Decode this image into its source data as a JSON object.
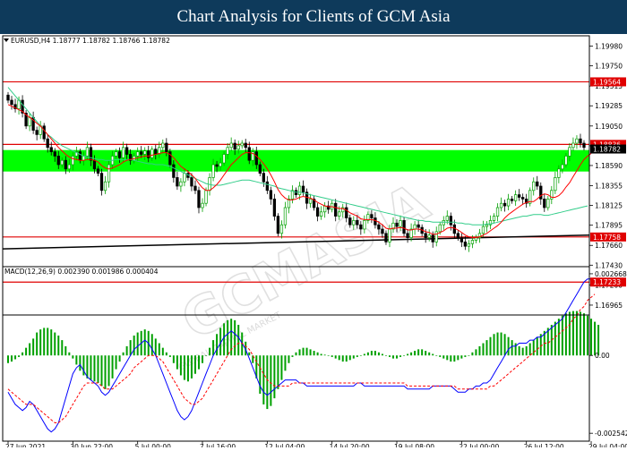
{
  "page_title": "Chart Analysis for Clients of GCM Asia",
  "watermark": "GCMASIA",
  "watermark_sub": "GLOBAL CAPITAL MARKET",
  "chart_data": [
    {
      "type": "candlestick",
      "panel": "price",
      "symbol_label": "EURUSD,H4  1.18777 1.18782 1.18766 1.18782",
      "ylim": [
        1.1685,
        1.201
      ],
      "y_ticks": [
        1.1998,
        1.1975,
        1.19515,
        1.19285,
        1.1905,
        1.1882,
        1.1859,
        1.18355,
        1.18125,
        1.17895,
        1.1766,
        1.1743,
        1.172,
        1.16965
      ],
      "y_tick_labels": [
        "1.19980",
        "1.19750",
        "1.19515",
        "1.19285",
        "1.19050",
        "1.18820",
        "1.18590",
        "1.18355",
        "1.18125",
        "1.17895",
        "1.17660",
        "1.17430",
        "1.17200",
        "1.16965"
      ],
      "x_labels": [
        "27 Jun 2021",
        "30 Jun 22:00",
        "5 Jul 00:00",
        "7 Jul 16:00",
        "12 Jul 04:00",
        "14 Jul 20:00",
        "19 Jul 08:00",
        "22 Jul 00:00",
        "26 Jul 12:00",
        "29 Jul 04:00"
      ],
      "x_label_bar_index": [
        0,
        18,
        36,
        54,
        72,
        90,
        108,
        126,
        144,
        162
      ],
      "closes": [
        1.1935,
        1.193,
        1.1925,
        1.1935,
        1.192,
        1.1905,
        1.1915,
        1.19,
        1.1895,
        1.1905,
        1.189,
        1.188,
        1.1875,
        1.187,
        1.186,
        1.1865,
        1.1855,
        1.186,
        1.187,
        1.1875,
        1.1865,
        1.187,
        1.188,
        1.1865,
        1.1855,
        1.185,
        1.183,
        1.184,
        1.186,
        1.187,
        1.1875,
        1.1868,
        1.188,
        1.1872,
        1.1865,
        1.187,
        1.1875,
        1.1872,
        1.1876,
        1.1868,
        1.1878,
        1.1872,
        1.188,
        1.1885,
        1.1875,
        1.186,
        1.1845,
        1.1835,
        1.184,
        1.185,
        1.1845,
        1.1835,
        1.183,
        1.181,
        1.1815,
        1.183,
        1.1845,
        1.186,
        1.1858,
        1.1862,
        1.1872,
        1.188,
        1.1885,
        1.1878,
        1.1882,
        1.1885,
        1.188,
        1.1865,
        1.1875,
        1.186,
        1.185,
        1.184,
        1.183,
        1.182,
        1.18,
        1.178,
        1.179,
        1.181,
        1.182,
        1.183,
        1.1825,
        1.1835,
        1.1828,
        1.1815,
        1.182,
        1.181,
        1.18,
        1.1805,
        1.1812,
        1.1808,
        1.1815,
        1.18,
        1.1805,
        1.181,
        1.1798,
        1.179,
        1.1795,
        1.179,
        1.1785,
        1.1795,
        1.1802,
        1.1798,
        1.179,
        1.1785,
        1.178,
        1.177,
        1.1785,
        1.1792,
        1.1788,
        1.1795,
        1.178,
        1.1775,
        1.1785,
        1.179,
        1.1787,
        1.178,
        1.1775,
        1.1778,
        1.177,
        1.1782,
        1.179,
        1.1795,
        1.18,
        1.179,
        1.178,
        1.1775,
        1.177,
        1.1765,
        1.1768,
        1.1772,
        1.1775,
        1.178,
        1.1788,
        1.179,
        1.1795,
        1.18,
        1.181,
        1.1815,
        1.1812,
        1.182,
        1.1818,
        1.1825,
        1.1822,
        1.182,
        1.1815,
        1.183,
        1.184,
        1.1835,
        1.182,
        1.181,
        1.182,
        1.183,
        1.1845,
        1.1855,
        1.186,
        1.187,
        1.188,
        1.1885,
        1.189,
        1.1885,
        1.188
      ],
      "ma_slow": [
        1.195,
        1.1945,
        1.194,
        1.1935,
        1.193,
        1.1925,
        1.192,
        1.1915,
        1.191,
        1.1905,
        1.19,
        1.1895,
        1.1892,
        1.1888,
        1.1885,
        1.1882,
        1.188,
        1.1878,
        1.1876,
        1.1874,
        1.1872,
        1.187,
        1.1869,
        1.1868,
        1.1867,
        1.1866,
        1.1866,
        1.1865,
        1.1865,
        1.1865,
        1.1866,
        1.1866,
        1.1866,
        1.1866,
        1.1866,
        1.1865,
        1.1864,
        1.1863,
        1.1862,
        1.1861,
        1.1861,
        1.186,
        1.186,
        1.186,
        1.1859,
        1.1858,
        1.1856,
        1.1854,
        1.1852,
        1.185,
        1.1848,
        1.1846,
        1.1844,
        1.1842,
        1.184,
        1.1838,
        1.1837,
        1.1836,
        1.1836,
        1.1836,
        1.1837,
        1.1838,
        1.1839,
        1.184,
        1.1841,
        1.1842,
        1.1842,
        1.1842,
        1.1841,
        1.184,
        1.1839,
        1.1838,
        1.1837,
        1.1836,
        1.1835,
        1.1833,
        1.1832,
        1.1831,
        1.183,
        1.1829,
        1.1828,
        1.1828,
        1.1827,
        1.1826,
        1.1825,
        1.1824,
        1.1823,
        1.1822,
        1.1821,
        1.182,
        1.1819,
        1.1818,
        1.1817,
        1.1816,
        1.1815,
        1.1814,
        1.1813,
        1.1812,
        1.1811,
        1.181,
        1.1809,
        1.1808,
        1.1807,
        1.1806,
        1.1805,
        1.1804,
        1.1803,
        1.1802,
        1.1801,
        1.18,
        1.1799,
        1.1798,
        1.1797,
        1.1796,
        1.1795,
        1.1795,
        1.1794,
        1.1794,
        1.1793,
        1.1793,
        1.1793,
        1.1793,
        1.1793,
        1.1793,
        1.1793,
        1.1792,
        1.1792,
        1.1791,
        1.1791,
        1.179,
        1.179,
        1.179,
        1.179,
        1.1791,
        1.1791,
        1.1792,
        1.1793,
        1.1794,
        1.1795,
        1.1796,
        1.1797,
        1.1798,
        1.1799,
        1.18,
        1.18,
        1.1801,
        1.1802,
        1.1802,
        1.1802,
        1.1801,
        1.1801,
        1.1802,
        1.1803,
        1.1804,
        1.1805,
        1.1806,
        1.1807,
        1.1808,
        1.1809,
        1.181,
        1.1811,
        1.1812
      ],
      "ma_fast": [
        1.193,
        1.1928,
        1.1926,
        1.1924,
        1.1922,
        1.1918,
        1.1915,
        1.1912,
        1.1908,
        1.1905,
        1.19,
        1.1895,
        1.189,
        1.1885,
        1.188,
        1.1876,
        1.1872,
        1.1869,
        1.1867,
        1.1866,
        1.1865,
        1.1865,
        1.1866,
        1.1866,
        1.1865,
        1.1863,
        1.1859,
        1.1856,
        1.1855,
        1.1856,
        1.1858,
        1.186,
        1.1863,
        1.1865,
        1.1866,
        1.1867,
        1.1868,
        1.1869,
        1.187,
        1.187,
        1.1871,
        1.1872,
        1.1873,
        1.1874,
        1.1874,
        1.1872,
        1.1868,
        1.1863,
        1.1858,
        1.1855,
        1.1852,
        1.1848,
        1.1844,
        1.1838,
        1.1833,
        1.183,
        1.183,
        1.1833,
        1.1837,
        1.1842,
        1.1848,
        1.1854,
        1.186,
        1.1864,
        1.1868,
        1.1872,
        1.1874,
        1.1874,
        1.1873,
        1.187,
        1.1866,
        1.1861,
        1.1855,
        1.1848,
        1.184,
        1.1831,
        1.1825,
        1.1821,
        1.1819,
        1.1819,
        1.182,
        1.1822,
        1.1823,
        1.1822,
        1.1821,
        1.1819,
        1.1816,
        1.1814,
        1.1812,
        1.1811,
        1.1811,
        1.181,
        1.1809,
        1.1809,
        1.1807,
        1.1804,
        1.1802,
        1.18,
        1.1797,
        1.1796,
        1.1796,
        1.1796,
        1.1795,
        1.1793,
        1.179,
        1.1786,
        1.1785,
        1.1786,
        1.1786,
        1.1787,
        1.1786,
        1.1784,
        1.1784,
        1.1785,
        1.1785,
        1.1784,
        1.1782,
        1.1781,
        1.1779,
        1.1779,
        1.1781,
        1.1783,
        1.1786,
        1.1787,
        1.1786,
        1.1784,
        1.1781,
        1.1778,
        1.1776,
        1.1775,
        1.1775,
        1.1776,
        1.1778,
        1.178,
        1.1783,
        1.1786,
        1.1789,
        1.1793,
        1.1798,
        1.1802,
        1.1805,
        1.1808,
        1.1811,
        1.1814,
        1.1816,
        1.1817,
        1.1817,
        1.182,
        1.1824,
        1.1826,
        1.1825,
        1.1822,
        1.1822,
        1.1824,
        1.1828,
        1.1834,
        1.1839,
        1.1846,
        1.1853,
        1.186,
        1.1866,
        1.187,
        1.1873
      ],
      "horizontal_lines": [
        {
          "price": 1.19564,
          "label": "1.19564",
          "color": "#e00000"
        },
        {
          "price": 1.18836,
          "label": "1.18836",
          "color": "#e00000"
        },
        {
          "price": 1.17758,
          "label": "1.17758",
          "color": "#e00000"
        },
        {
          "price": 1.17233,
          "label": "1.17233",
          "color": "#e00000"
        }
      ],
      "current_price": {
        "price": 1.18782,
        "label": "1.18782"
      },
      "zone": {
        "from": 1.1852,
        "to": 1.1877,
        "color": "#00ff00"
      },
      "trendline": {
        "from": [
          0,
          1.1762
        ],
        "to": [
          166,
          1.1778
        ],
        "color": "#000000"
      },
      "colors": {
        "up": "#00a000",
        "down": "#000000",
        "ma_fast": "#ff0000",
        "ma_slow": "#32cd8a",
        "grid": "#ffffff",
        "border": "#000000"
      }
    },
    {
      "type": "macd",
      "panel": "indicator",
      "label": "MACD(12,26,9) 0.002390 0.001986 0.000404",
      "ylim": [
        -0.0028,
        0.0029
      ],
      "y_ticks": [
        0.002668,
        0.0,
        -0.002542
      ],
      "y_tick_labels": [
        "0.002668",
        "0.00",
        "-0.002542"
      ],
      "histogram": [
        -0.0001,
        -8e-05,
        -5e-05,
        -2e-05,
        4e-05,
        0.0001,
        0.00016,
        0.00022,
        0.0003,
        0.00034,
        0.00036,
        0.00036,
        0.00034,
        0.0003,
        0.00026,
        0.0002,
        0.00012,
        4e-05,
        -4e-05,
        -0.00012,
        -0.0002,
        -0.00026,
        -0.0003,
        -0.00032,
        -0.00034,
        -0.00036,
        -0.0004,
        -0.00044,
        -0.0004,
        -0.0003,
        -0.00018,
        -8e-05,
        4e-05,
        0.00012,
        0.0002,
        0.00026,
        0.0003,
        0.00032,
        0.00034,
        0.00032,
        0.00028,
        0.00022,
        0.00016,
        0.0001,
        4e-05,
        -2e-05,
        -0.0001,
        -0.00018,
        -0.00026,
        -0.00032,
        -0.00034,
        -0.0003,
        -0.00024,
        -0.00018,
        -0.0001,
        0.0,
        0.0001,
        0.0002,
        0.00028,
        0.00036,
        0.00042,
        0.00046,
        0.00048,
        0.00046,
        0.0004,
        0.0003,
        0.00018,
        4e-05,
        -0.0001,
        -0.0003,
        -0.0005,
        -0.00064,
        -0.0007,
        -0.00066,
        -0.00056,
        -0.00044,
        -0.00032,
        -0.0002,
        -0.0001,
        -2e-05,
        4e-05,
        8e-05,
        0.0001,
        0.0001,
        8e-05,
        6e-05,
        4e-05,
        2e-05,
        1e-05,
        0.0,
        -2e-05,
        -4e-05,
        -6e-05,
        -8e-05,
        -8e-05,
        -6e-05,
        -4e-05,
        -2e-05,
        0.0,
        2e-05,
        4e-05,
        6e-05,
        6e-05,
        4e-05,
        2e-05,
        0.0,
        -2e-05,
        -4e-05,
        -4e-05,
        -2e-05,
        0.0,
        2e-05,
        4e-05,
        6e-05,
        8e-05,
        8e-05,
        6e-05,
        4e-05,
        2e-05,
        0.0,
        -2e-05,
        -4e-05,
        -6e-05,
        -8e-05,
        -8e-05,
        -6e-05,
        -4e-05,
        -2e-05,
        0.0,
        4e-05,
        8e-05,
        0.00012,
        0.00016,
        0.0002,
        0.00024,
        0.00028,
        0.0003,
        0.0003,
        0.00028,
        0.00024,
        0.0002,
        0.00016,
        0.00012,
        0.0001,
        0.00012,
        0.00016,
        0.0002,
        0.00024,
        0.00028,
        0.00032,
        0.00036,
        0.0004,
        0.00044,
        0.00048,
        0.00052,
        0.00055,
        0.00057,
        0.00058,
        0.00058,
        0.00057,
        0.00055,
        0.00052,
        0.00048,
        0.00044,
        0.0004
      ],
      "macd": [
        -0.0012,
        -0.0014,
        -0.0016,
        -0.0017,
        -0.0018,
        -0.0017,
        -0.0015,
        -0.0016,
        -0.0018,
        -0.002,
        -0.0022,
        -0.0024,
        -0.0025,
        -0.0024,
        -0.0022,
        -0.0018,
        -0.0014,
        -0.001,
        -0.0006,
        -0.0004,
        -0.0003,
        -0.0005,
        -0.0007,
        -0.0008,
        -0.0009,
        -0.001,
        -0.0012,
        -0.0013,
        -0.0012,
        -0.001,
        -0.0008,
        -0.0006,
        -0.0004,
        -0.0002,
        0.0,
        0.0002,
        0.0003,
        0.0004,
        0.0005,
        0.0004,
        0.0002,
        0.0,
        -0.0003,
        -0.0006,
        -0.0009,
        -0.0012,
        -0.0015,
        -0.0018,
        -0.002,
        -0.0021,
        -0.002,
        -0.0018,
        -0.0015,
        -0.0012,
        -0.0009,
        -0.0006,
        -0.0003,
        0.0,
        0.0002,
        0.0004,
        0.0006,
        0.0007,
        0.0008,
        0.0007,
        0.0006,
        0.0004,
        0.0002,
        -0.0001,
        -0.0004,
        -0.0007,
        -0.001,
        -0.0012,
        -0.0013,
        -0.0012,
        -0.0011,
        -0.001,
        -0.0009,
        -0.0008,
        -0.0008,
        -0.0008,
        -0.0008,
        -0.0009,
        -0.0009,
        -0.001,
        -0.001,
        -0.001,
        -0.001,
        -0.001,
        -0.001,
        -0.001,
        -0.001,
        -0.001,
        -0.001,
        -0.001,
        -0.001,
        -0.001,
        -0.001,
        -0.0009,
        -0.0009,
        -0.001,
        -0.001,
        -0.001,
        -0.001,
        -0.001,
        -0.001,
        -0.001,
        -0.001,
        -0.001,
        -0.001,
        -0.001,
        -0.001,
        -0.0011,
        -0.0011,
        -0.0011,
        -0.0011,
        -0.0011,
        -0.0011,
        -0.0011,
        -0.001,
        -0.001,
        -0.001,
        -0.001,
        -0.001,
        -0.001,
        -0.0011,
        -0.0012,
        -0.0012,
        -0.0012,
        -0.0011,
        -0.0011,
        -0.001,
        -0.001,
        -0.0009,
        -0.0009,
        -0.0008,
        -0.0006,
        -0.0004,
        -0.0002,
        0.0,
        0.0002,
        0.0003,
        0.0003,
        0.0004,
        0.0004,
        0.0004,
        0.0005,
        0.0005,
        0.0006,
        0.0006,
        0.0007,
        0.0008,
        0.0009,
        0.001,
        0.0011,
        0.0012,
        0.0014,
        0.0016,
        0.0018,
        0.002,
        0.0022,
        0.0024,
        0.0025,
        0.0025,
        0.0024
      ],
      "signal": [
        -0.0011,
        -0.0012,
        -0.0013,
        -0.0014,
        -0.0015,
        -0.0016,
        -0.0016,
        -0.0016,
        -0.0017,
        -0.0018,
        -0.0019,
        -0.002,
        -0.0021,
        -0.0022,
        -0.0022,
        -0.0021,
        -0.002,
        -0.0018,
        -0.0016,
        -0.0014,
        -0.0012,
        -0.001,
        -0.0009,
        -0.0009,
        -0.0009,
        -0.0009,
        -0.001,
        -0.0011,
        -0.0011,
        -0.0011,
        -0.001,
        -0.0009,
        -0.0008,
        -0.0007,
        -0.0006,
        -0.0004,
        -0.0003,
        -0.0002,
        -0.0001,
        0.0,
        0.0,
        0.0,
        -0.0001,
        -0.0002,
        -0.0004,
        -0.0006,
        -0.0008,
        -0.001,
        -0.0012,
        -0.0014,
        -0.0015,
        -0.0016,
        -0.0016,
        -0.0015,
        -0.0014,
        -0.0012,
        -0.001,
        -0.0008,
        -0.0006,
        -0.0004,
        -0.0002,
        0.0,
        0.0002,
        0.0003,
        0.0004,
        0.0004,
        0.0003,
        0.0002,
        0.0,
        -0.0002,
        -0.0004,
        -0.0006,
        -0.0008,
        -0.0009,
        -0.001,
        -0.001,
        -0.001,
        -0.001,
        -0.001,
        -0.0009,
        -0.0009,
        -0.0009,
        -0.0009,
        -0.0009,
        -0.0009,
        -0.0009,
        -0.0009,
        -0.0009,
        -0.0009,
        -0.0009,
        -0.0009,
        -0.0009,
        -0.0009,
        -0.0009,
        -0.0009,
        -0.0009,
        -0.0009,
        -0.0009,
        -0.0009,
        -0.0009,
        -0.0009,
        -0.0009,
        -0.0009,
        -0.0009,
        -0.0009,
        -0.0009,
        -0.0009,
        -0.0009,
        -0.0009,
        -0.0009,
        -0.0009,
        -0.001,
        -0.001,
        -0.001,
        -0.001,
        -0.001,
        -0.001,
        -0.001,
        -0.001,
        -0.001,
        -0.001,
        -0.001,
        -0.001,
        -0.001,
        -0.001,
        -0.0011,
        -0.0011,
        -0.0011,
        -0.0011,
        -0.0011,
        -0.0011,
        -0.0011,
        -0.0011,
        -0.0011,
        -0.001,
        -0.001,
        -0.0009,
        -0.0008,
        -0.0007,
        -0.0006,
        -0.0005,
        -0.0004,
        -0.0003,
        -0.0002,
        -0.0001,
        0.0,
        0.0001,
        0.0002,
        0.0003,
        0.0004,
        0.0004,
        0.0005,
        0.0006,
        0.0007,
        0.0008,
        0.0009,
        0.001,
        0.0012,
        0.0013,
        0.0015,
        0.0016,
        0.0018,
        0.0019,
        0.002
      ],
      "colors": {
        "histogram": "#00a000",
        "macd": "#0000ff",
        "signal": "#ff0000"
      }
    }
  ]
}
